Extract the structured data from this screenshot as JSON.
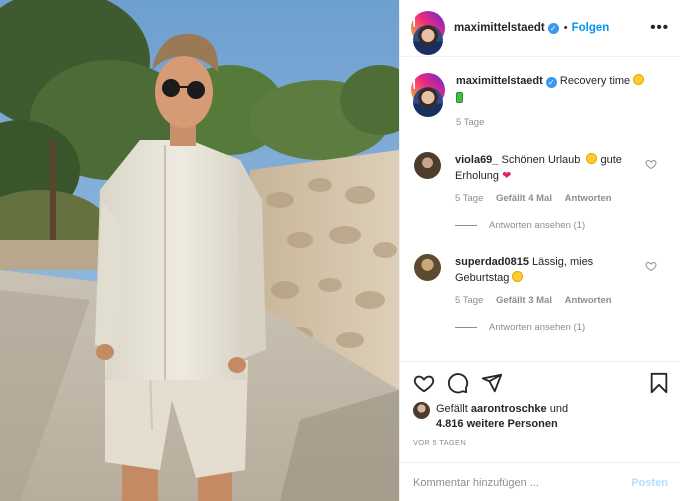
{
  "post": {
    "author": "maximittelstaedt",
    "separator": "•",
    "follow_label": "Folgen",
    "more_icon": "more-icon",
    "more_glyph": "•••",
    "verified_glyph": "✓"
  },
  "caption": {
    "username": "maximittelstaedt",
    "text": "Recovery time",
    "emojis": [
      "sun-emoji",
      "battery-emoji"
    ],
    "time": "5 Tage"
  },
  "comments": [
    {
      "username": "viola69_",
      "text_before": "Schönen Urlaub",
      "text_after": "gute Erholung",
      "heart_glyph": "❤",
      "time": "5 Tage",
      "likes": "Gefällt 4 Mal",
      "reply": "Antworten",
      "view_replies": "Antworten ansehen (1)"
    },
    {
      "username": "superdad0815",
      "text_before": "Lässig, mies Geburtstag",
      "time": "5 Tage",
      "likes": "Gefällt 3 Mal",
      "reply": "Antworten",
      "view_replies": "Antworten ansehen (1)"
    }
  ],
  "actions": {
    "icons": [
      "heart-icon",
      "comment-icon",
      "share-icon",
      "bookmark-icon"
    ]
  },
  "likes": {
    "prefix": "Gefällt",
    "user": "aarontroschke",
    "middle": "und",
    "others": "4.816 weitere Personen"
  },
  "date": "VOR 5 TAGEN",
  "comment_box": {
    "placeholder": "Kommentar hinzufügen ...",
    "post_label": "Posten"
  },
  "colors": {
    "link_blue": "#0095f6",
    "post_disabled": "#b2dffc",
    "verified": "#3897f0",
    "muted": "#8e8e8e"
  }
}
